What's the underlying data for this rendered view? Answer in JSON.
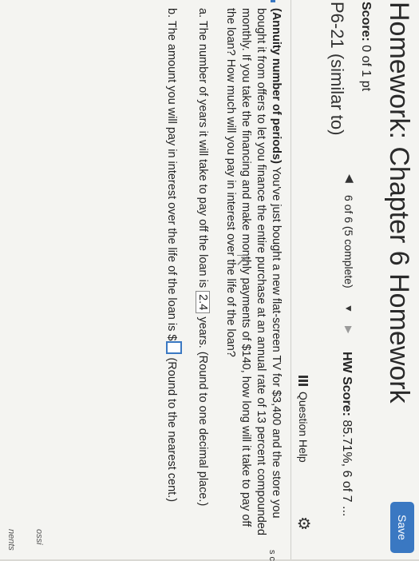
{
  "header": {
    "title": "Homework: Chapter 6 Homework",
    "save_label": "Save"
  },
  "score": {
    "label": "Score:",
    "value": "0 of 1 pt"
  },
  "navigation": {
    "progress": "6 of 6 (5 complete)"
  },
  "hw_score": {
    "label": "HW Score:",
    "value": "85.71%, 6 of 7 ..."
  },
  "problem": {
    "id": "P6-21 (similar to)",
    "help_label": "Question Help"
  },
  "question": {
    "bold_lead": "(Annuity number of periods)",
    "text": "You've just bought a new flat-screen TV for $3,400 and the store you bought it from offers to let you finance the entire purchase at an annual rate of 13 percent compounded monthly. If you take the financing and make monthly payments of $140, how long will it take to pay off the loan? How much will you pay in interest over the life of the loan?"
  },
  "part_a": {
    "prefix": "a.  The number of years it will take to pay off the loan is",
    "answer": "2.4",
    "suffix": "years.",
    "hint": "(Round to one decimal place.)"
  },
  "part_b": {
    "prefix": "b.  The amount you will pay in interest over the life of the loan is $",
    "hint": "(Round to the nearest cent.)"
  },
  "edge_text": {
    "a": "s c",
    "b": "ossi",
    "c": "nents"
  }
}
